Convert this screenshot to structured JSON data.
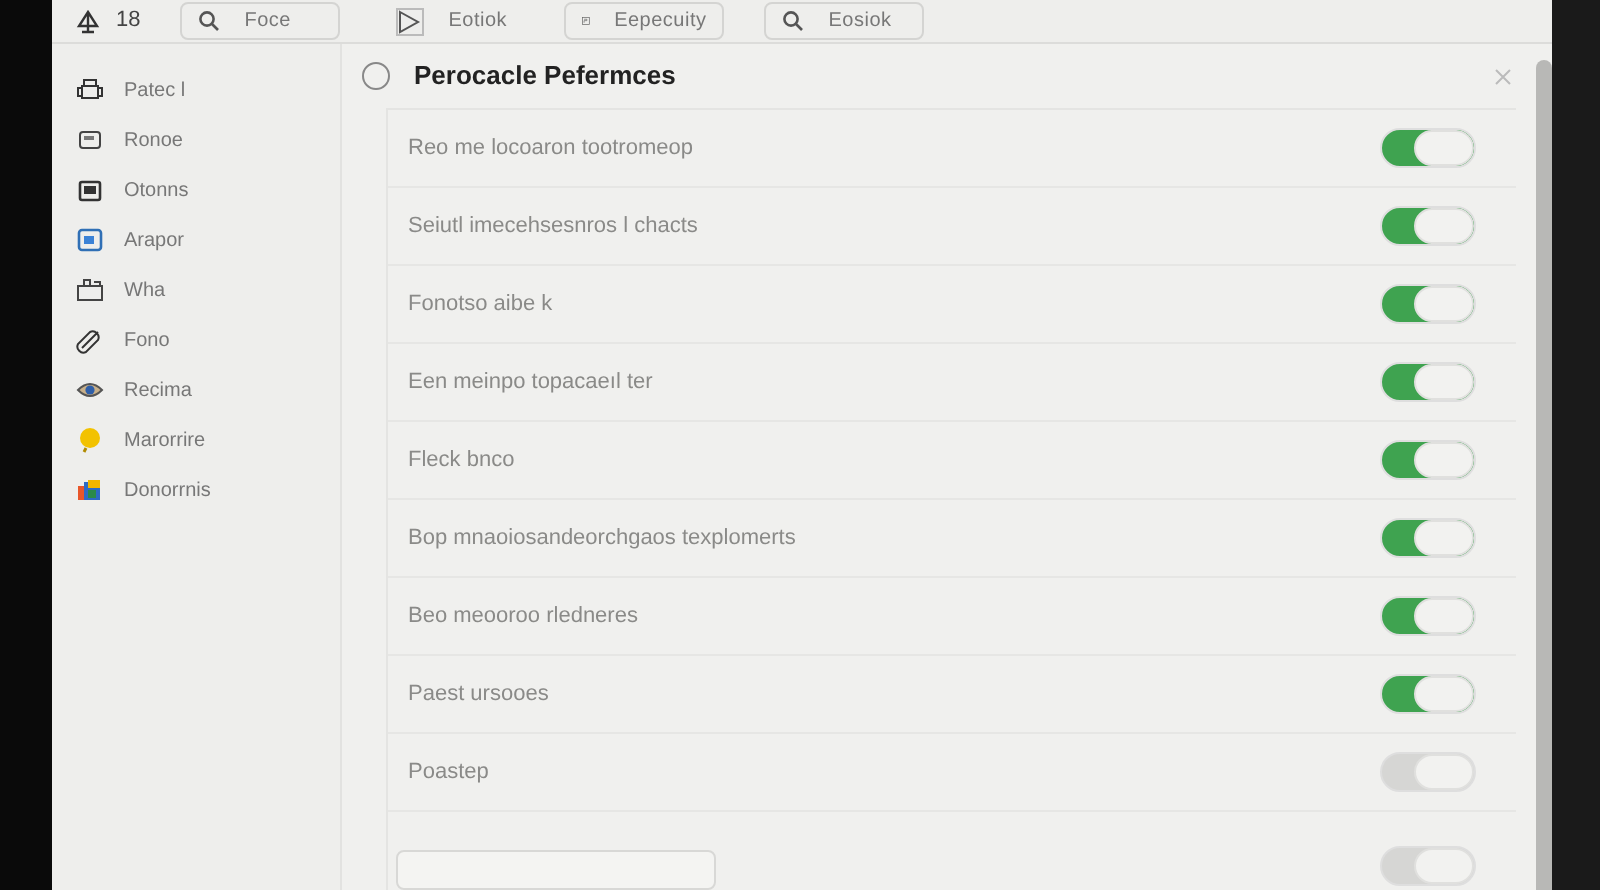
{
  "toolbar": {
    "counter": "18",
    "buttons": [
      {
        "kind": "search",
        "label": "Foce"
      },
      {
        "kind": "play",
        "label": "Eotiok"
      },
      {
        "kind": "square",
        "label": "Eepecuity"
      },
      {
        "kind": "search",
        "label": "Eosiok"
      }
    ]
  },
  "sidebar": {
    "items": [
      {
        "label": "Patec l"
      },
      {
        "label": "Ronoe"
      },
      {
        "label": "Otonns"
      },
      {
        "label": "Arapor"
      },
      {
        "label": "Wha"
      },
      {
        "label": "Fono"
      },
      {
        "label": "Recima"
      },
      {
        "label": "Marorrire"
      },
      {
        "label": "Donorrnis"
      }
    ]
  },
  "panel": {
    "title": "Perocacle Pefermces",
    "selected": false,
    "rows": [
      {
        "kind": "toggle",
        "label": "Reo me locoaron tootromeop",
        "on": true
      },
      {
        "kind": "toggle",
        "label": "Seiutl imecehsesnros l chacts",
        "on": true
      },
      {
        "kind": "toggle",
        "label": "Fonotso aibe k",
        "on": true
      },
      {
        "kind": "toggle",
        "label": "Een meinpo topacaeıl ter",
        "on": true
      },
      {
        "kind": "toggle",
        "label": "Fleck bnco",
        "on": true
      },
      {
        "kind": "toggle",
        "label": "Bop mnaoiosandeorchgaos texplomerts",
        "on": true
      },
      {
        "kind": "toggle",
        "label": "Beo meooroo rledneres",
        "on": true
      },
      {
        "kind": "toggle",
        "label": "Paest ursooes",
        "on": true
      },
      {
        "kind": "toggle",
        "label": "Poastep",
        "on": false
      },
      {
        "kind": "field",
        "on": false
      }
    ]
  }
}
